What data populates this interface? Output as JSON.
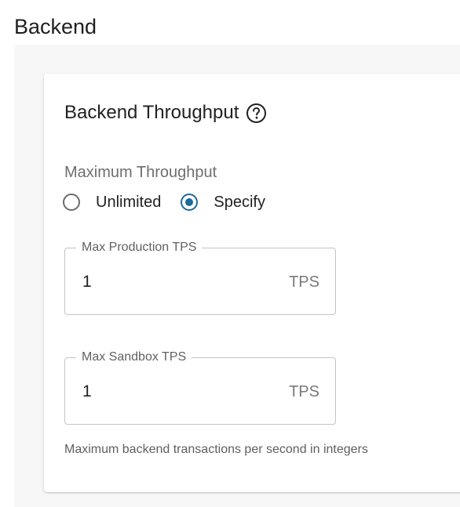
{
  "section": {
    "title": "Backend"
  },
  "card": {
    "title": "Backend Throughput",
    "help_icon": "help-circle-icon"
  },
  "throughput": {
    "group_label": "Maximum Throughput",
    "options": [
      {
        "label": "Unlimited",
        "selected": false
      },
      {
        "label": "Specify",
        "selected": true
      }
    ],
    "accent_color": "#1b6a9c"
  },
  "fields": {
    "production": {
      "label": "Max Production TPS",
      "value": "1",
      "unit": "TPS"
    },
    "sandbox": {
      "label": "Max Sandbox TPS",
      "value": "1",
      "unit": "TPS"
    }
  },
  "helper_text": "Maximum backend transactions per second in integers"
}
